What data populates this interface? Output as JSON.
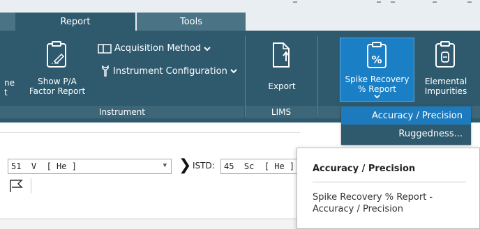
{
  "tabs": [
    {
      "label": ""
    },
    {
      "label": "Report"
    },
    {
      "label": "Tools"
    }
  ],
  "ribbon": {
    "cut_left_label_line1": "ne",
    "cut_left_label_line2": "t",
    "show_pa_line1": "Show P/A",
    "show_pa_line2": "Factor Report",
    "acquisition_method": "Acquisition Method",
    "instrument_configuration": "Instrument Configuration",
    "export_label": "Export",
    "spike_line1": "Spike Recovery",
    "spike_line2": "% Report",
    "elemental_line1": "Elemental",
    "elemental_line2": "Impurities",
    "groups": {
      "instrument": "Instrument",
      "lims": "LIMS",
      "partial": ""
    },
    "icon_names": {
      "show_pa": "report-edit-icon",
      "acquisition": "window-icon",
      "instrument_config": "wrench-icon",
      "export": "export-icon",
      "spike": "percent-clipboard-icon",
      "elemental": "element-clipboard-icon"
    }
  },
  "dropdown_menu": {
    "items": [
      {
        "label": "Accuracy / Precision",
        "highlighted": true
      },
      {
        "label": "Ruggedness..."
      }
    ]
  },
  "toolbar_row": {
    "element_select": "51  V  [ He ]",
    "istd_label": "ISTD:",
    "istd_value": "45  Sc  [ He ]"
  },
  "tooltip": {
    "title": "Accuracy / Precision",
    "description": "Spike Recovery % Report - Accuracy / Precision"
  },
  "colors": {
    "ribbon_bg": "#2f5a6e",
    "highlight": "#1a7fc4",
    "tab_strip": "#e9eef2"
  }
}
